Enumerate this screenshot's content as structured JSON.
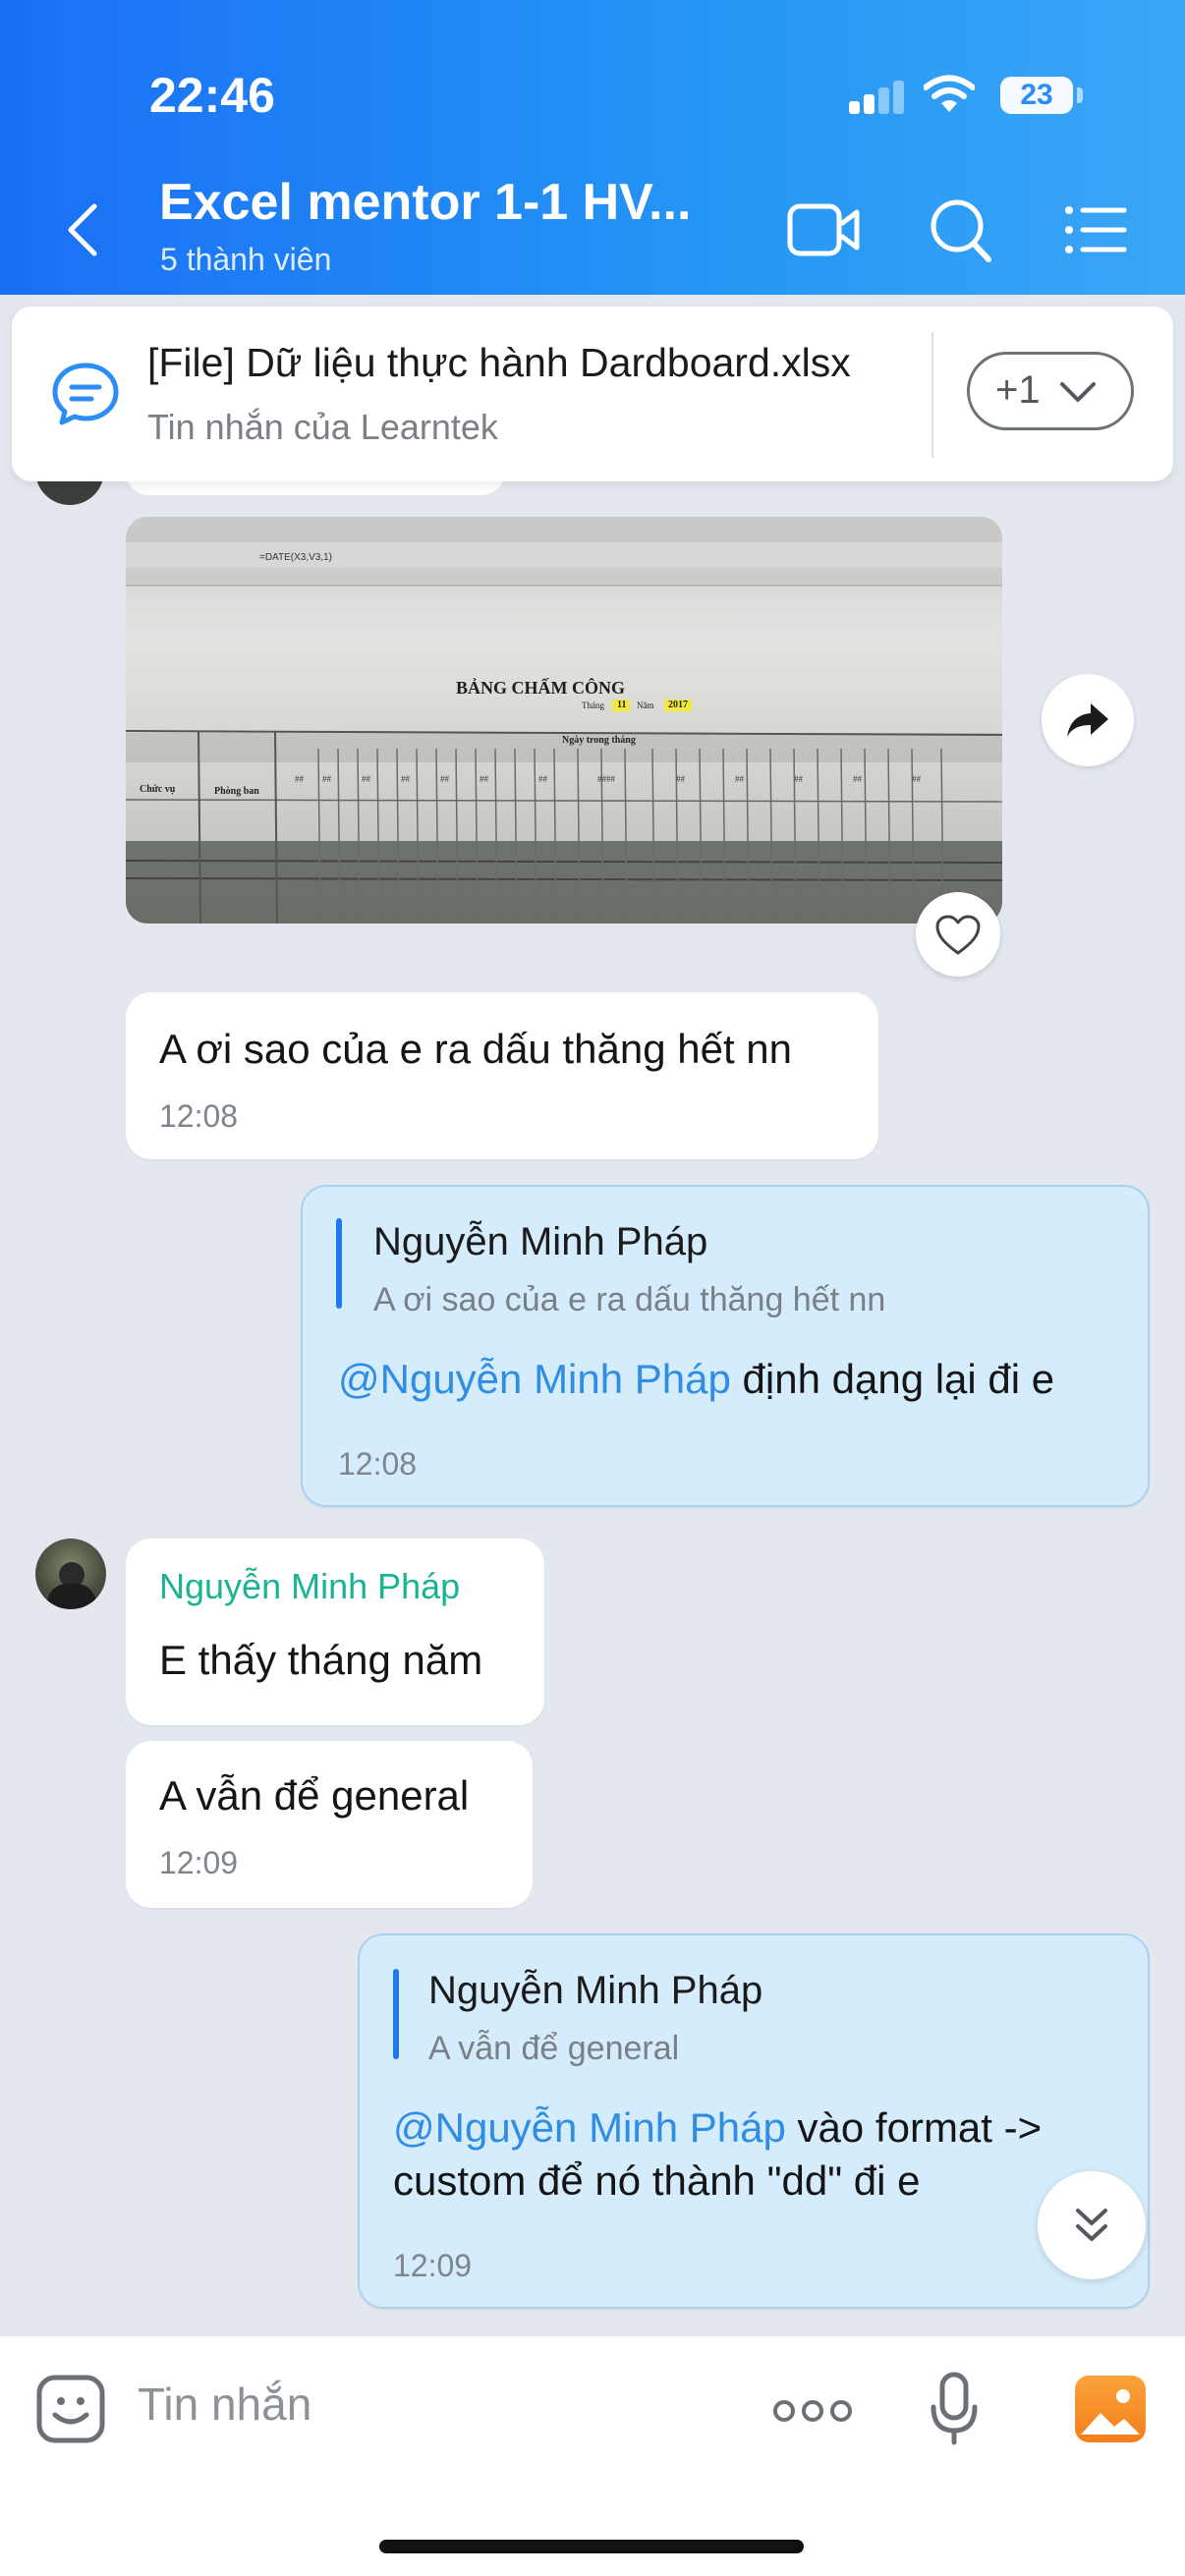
{
  "status_bar": {
    "time": "22:46",
    "battery": "23"
  },
  "header": {
    "title": "Excel mentor 1-1 HV...",
    "subtitle": "5 thành viên"
  },
  "pinned": {
    "title": "[File] Dữ liệu thực hành Dardboard.xlsx",
    "subtitle": "Tin nhắn của Learntek",
    "more_label": "+1"
  },
  "image_msg": {
    "sheet_title": "BẢNG CHẤM CÔNG",
    "sheet_month_label": "Tháng",
    "sheet_month": "11",
    "sheet_year_label": "Năm",
    "sheet_year": "2017",
    "sheet_days_header": "Ngày trong tháng",
    "col_position": "Chức vụ",
    "col_department": "Phòng ban",
    "formula": "=DATE(X3,V3,1)"
  },
  "messages": [
    {
      "text": "A ơi sao của e ra dấu thăng hết nn",
      "time": "12:08"
    },
    {
      "quote_name": "Nguyễn Minh Pháp",
      "quote_text": "A ơi sao của e ra dấu thăng hết nn",
      "mention": "@Nguyễn Minh Pháp",
      "text": " định dạng lại đi e",
      "time": "12:08"
    },
    {
      "sender": "Nguyễn Minh Pháp",
      "text": "E thấy tháng năm"
    },
    {
      "text": "A vẫn để general",
      "time": "12:09"
    },
    {
      "quote_name": "Nguyễn Minh Pháp",
      "quote_text": "A vẫn để general",
      "mention": "@Nguyễn Minh Pháp",
      "text": " vào format ->",
      "text2": "custom để nó thành \"dd\" đi e",
      "time": "12:09"
    }
  ],
  "input": {
    "placeholder": "Tin nhắn"
  },
  "colors": {
    "header_blue": "#1a6ff5",
    "my_bubble": "#d4ecfc",
    "mention": "#2f8de4",
    "sender_name": "#1ab394"
  }
}
